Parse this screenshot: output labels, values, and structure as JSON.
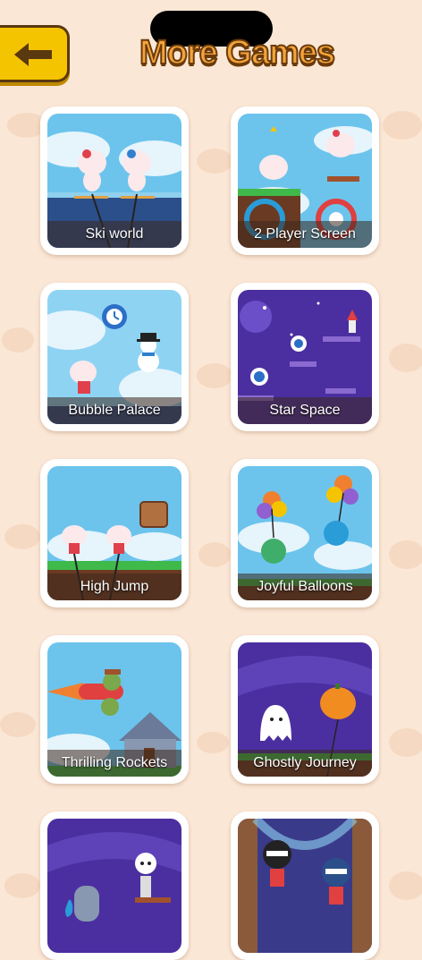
{
  "header": {
    "title": "More Games",
    "back_icon": "arrow-left-icon"
  },
  "games": [
    {
      "label": "Ski world"
    },
    {
      "label": "2 Player Screen"
    },
    {
      "label": "Bubble Palace"
    },
    {
      "label": "Star Space"
    },
    {
      "label": "High Jump"
    },
    {
      "label": "Joyful Balloons"
    },
    {
      "label": "Thrilling Rockets"
    },
    {
      "label": "Ghostly Journey"
    },
    {
      "label": ""
    },
    {
      "label": ""
    }
  ],
  "colors": {
    "background": "#fbe7d6",
    "back_button": "#f5c400",
    "title_fill": "#f3a53a",
    "title_outline": "#6b3a0a"
  }
}
